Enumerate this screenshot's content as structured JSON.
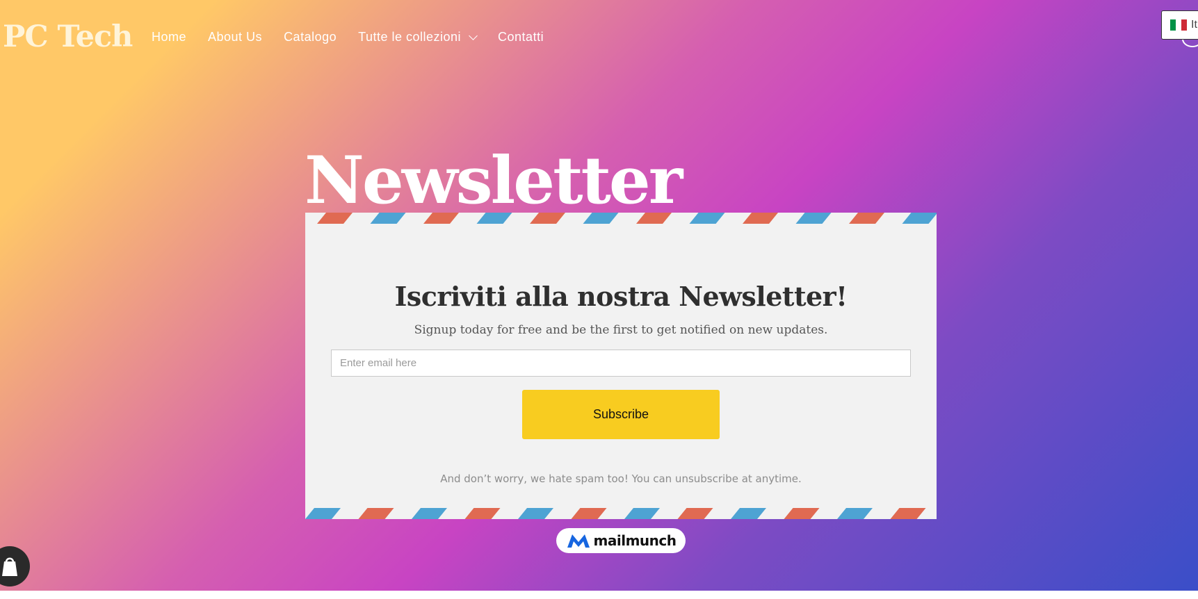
{
  "brand": {
    "logo_text": "PC Tech"
  },
  "nav": {
    "items": [
      {
        "label": "Home"
      },
      {
        "label": "About Us"
      },
      {
        "label": "Catalogo"
      },
      {
        "label": "Tutte le collezioni"
      },
      {
        "label": "Contatti"
      }
    ]
  },
  "language": {
    "current": "It",
    "icon": "italy-flag-icon"
  },
  "page": {
    "title": "Newsletter"
  },
  "newsletter": {
    "heading": "Iscriviti alla nostra Newsletter!",
    "subheading": "Signup today for free and be the first to get notified on new updates.",
    "email_placeholder": "Enter email here",
    "email_value": "",
    "subscribe_label": "Subscribe",
    "footer_note": "And don’t worry, we hate spam too! You can unsubscribe at anytime.",
    "stripe_colors": [
      "#e06a52",
      "#4ea3d3"
    ]
  },
  "badge": {
    "brand_text": "mailmunch"
  },
  "colors": {
    "accent_button": "#f8cc20",
    "card_background": "#f2f2f2",
    "gradient": [
      "#ffc867",
      "#c844c3",
      "#3a4ec8"
    ]
  }
}
